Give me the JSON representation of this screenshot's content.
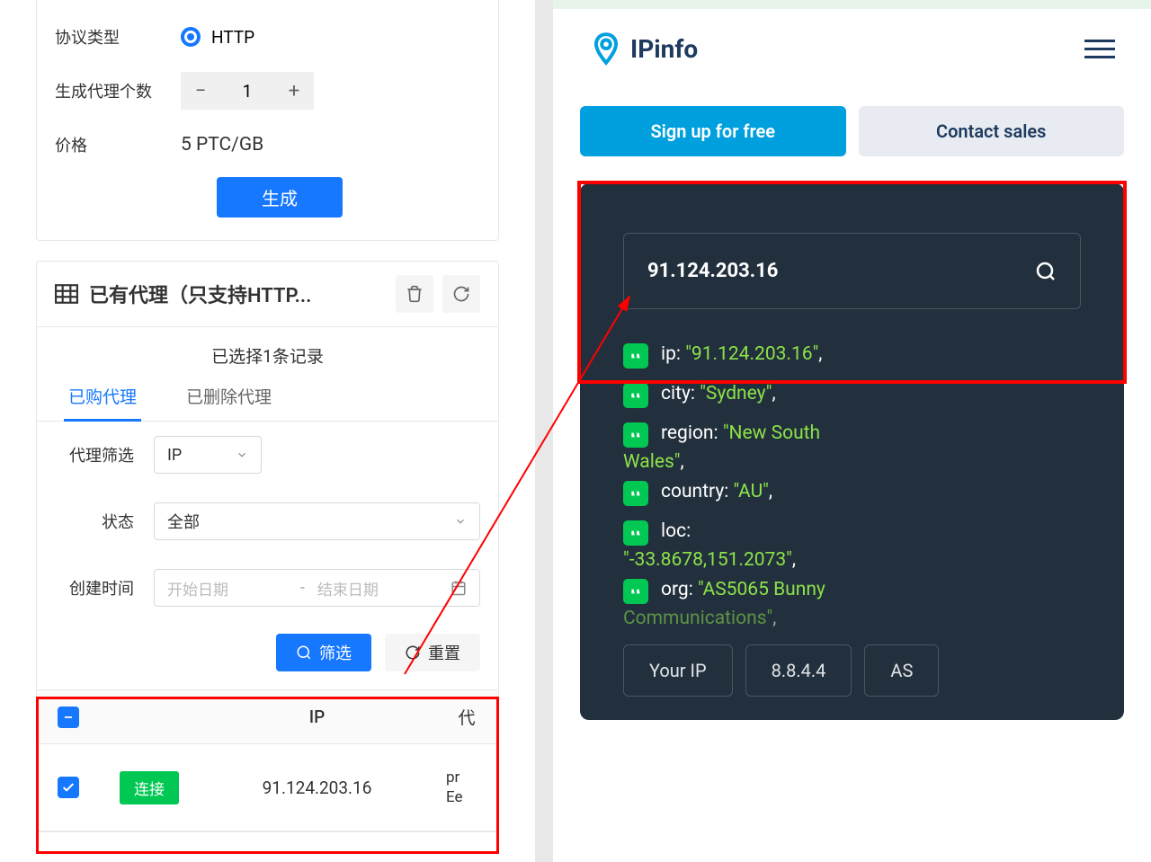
{
  "left": {
    "protocol_label": "协议类型",
    "protocol_value": "HTTP",
    "count_label": "生成代理个数",
    "count_value": "1",
    "price_label": "价格",
    "price_value": "5 PTC/GB",
    "generate_btn": "生成",
    "table_title": "已有代理（只支持HTTP...",
    "selected_info": "已选择1条记录",
    "tabs": [
      "已购代理",
      "已删除代理"
    ],
    "filter_label": "代理筛选",
    "filter_mode": "IP",
    "status_label": "状态",
    "status_value": "全部",
    "date_label": "创建时间",
    "date_start": "开始日期",
    "date_end": "结束日期",
    "filter_btn": "筛选",
    "reset_btn": "重置",
    "cols": {
      "check": "",
      "status": "",
      "ip": "IP",
      "proxy": "代"
    },
    "row": {
      "status": "连接",
      "ip": "91.124.203.16",
      "proxy_frag": "pr\nEe"
    }
  },
  "right": {
    "brand": "IPinfo",
    "cta_signup": "Sign up for free",
    "cta_contact": "Contact sales",
    "search_ip": "91.124.203.16",
    "yourip": "Your IP",
    "example_ip": "8.8.4.4",
    "example_as": "AS",
    "json": [
      {
        "key": "ip",
        "val": "\"91.124.203.16\""
      },
      {
        "key": "city",
        "val": "\"Sydney\""
      },
      {
        "key": "region",
        "val": "\"New South Wales\""
      },
      {
        "key": "country",
        "val": "\"AU\""
      },
      {
        "key": "loc",
        "val": "\"-33.8678,151.2073\""
      },
      {
        "key": "org",
        "val": "\"AS5065 Bunny Communications\""
      }
    ]
  }
}
